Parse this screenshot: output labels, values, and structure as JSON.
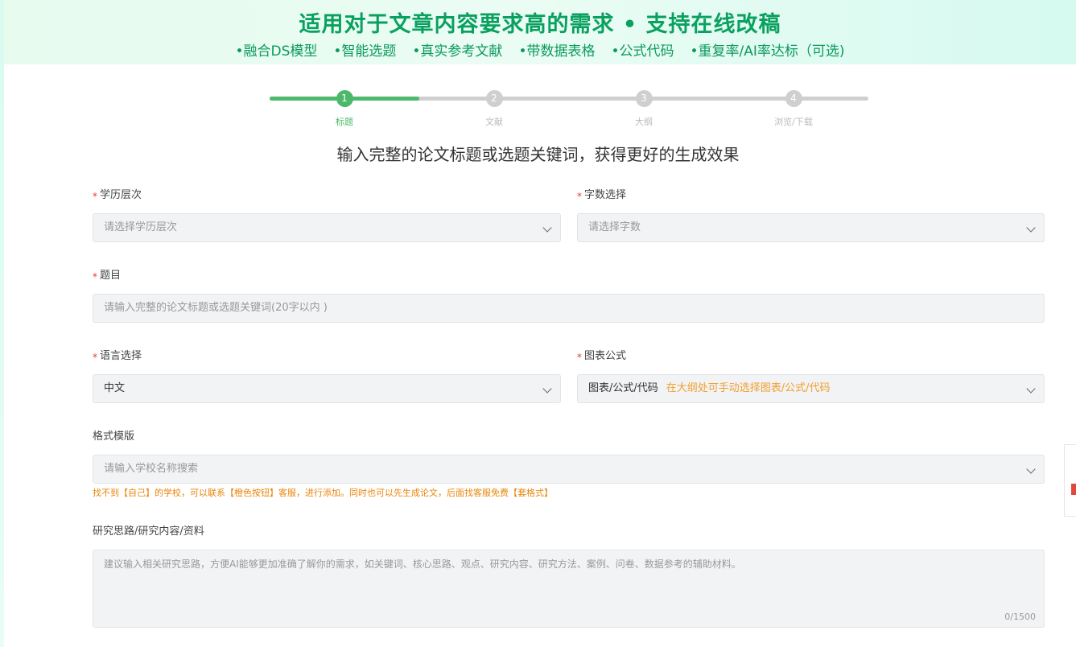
{
  "banner": {
    "title": "适用对于文章内容要求高的需求 • 支持在线改稿",
    "features": [
      "•融合DS模型",
      "•智能选题",
      "•真实参考文献",
      "•带数据表格",
      "•公式代码",
      "•重复率/AI率达标（可选)"
    ]
  },
  "steps": [
    {
      "num": "1",
      "label": "标题",
      "active": true
    },
    {
      "num": "2",
      "label": "文献",
      "active": false
    },
    {
      "num": "3",
      "label": "大纲",
      "active": false
    },
    {
      "num": "4",
      "label": "浏览/下载",
      "active": false
    }
  ],
  "progress_fraction": 0.25,
  "subtitle": "输入完整的论文标题或选题关键词，获得更好的生成效果",
  "form": {
    "required_mark": "*",
    "education": {
      "label": "学历层次",
      "placeholder": "请选择学历层次"
    },
    "wordcount": {
      "label": "字数选择",
      "placeholder": "请选择字数"
    },
    "topic": {
      "label": "题目",
      "placeholder": "请输入完整的论文标题或选题关键词(20字以内 )"
    },
    "language": {
      "label": "语言选择",
      "value": "中文"
    },
    "charts": {
      "label": "图表公式",
      "value": "图表/公式/代码",
      "hint": "在大纲处可手动选择图表/公式/代码"
    },
    "template": {
      "label": "格式模版",
      "placeholder": "请输入学校名称搜索"
    },
    "template_note": "找不到【自己】的学校，可以联系【橙色按钮】客服，进行添加。同时也可以先生成论文，后面找客服免费【套格式】",
    "research": {
      "label": "研究思路/研究内容/资料",
      "placeholder": "建议输入相关研究思路，方便AI能够更加准确了解你的需求，如关键词、核心思路、观点、研究内容、研究方法、案例、问卷、数据参考的辅助材料。",
      "counter": "0/1500"
    }
  },
  "colors": {
    "accent": "#4cb86a",
    "banner_text": "#0aa060",
    "hint": "#f0a030",
    "required": "#e53935"
  }
}
